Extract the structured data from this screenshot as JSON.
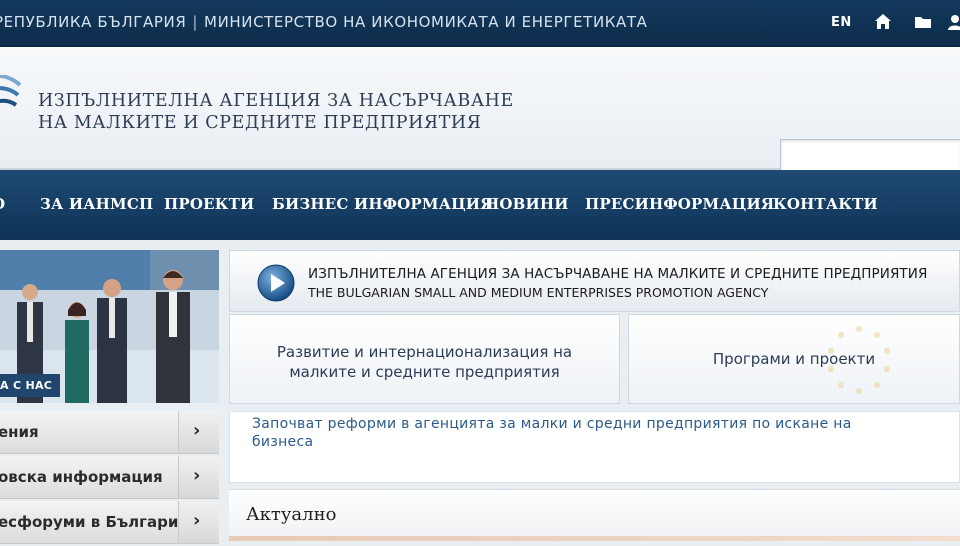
{
  "topbar": {
    "country": "РЕПУБЛИКА БЪЛГАРИЯ",
    "separator": "|",
    "ministry": "МИНИСТЕРСТВО НА ИКОНОМИКАТА И ЕНЕРГЕТИКАТА",
    "lang": "EN"
  },
  "header": {
    "agency_line1": "ИЗПЪЛНИТЕЛНА АГЕНЦИЯ ЗА НАСЪРЧАВАНЕ",
    "agency_line2": "НА МАЛКИТЕ И СРЕДНИТЕ ПРЕДПРИЯТИЯ",
    "search_placeholder": ""
  },
  "nav": {
    "items": [
      "О",
      "ЗА ИАНМСП",
      "ПРОЕКТИ",
      "БИЗНЕС ИНФОРМАЦИЯ",
      "НОВИНИ",
      "ПРЕСИНФОРМАЦИЯ",
      "КОНТАКТИ"
    ]
  },
  "photo": {
    "label": "А С НАС"
  },
  "side": {
    "items": [
      {
        "label": "ения",
        "arrow": "›"
      },
      {
        "label": "овска информация",
        "arrow": "›"
      },
      {
        "label": "есфоруми в България",
        "arrow": "›"
      }
    ]
  },
  "banner": {
    "line1": "ИЗПЪЛНИТЕЛНА АГЕНЦИЯ ЗА НАСЪРЧАВАНЕ НА МАЛКИТЕ И СРЕДНИТЕ ПРЕДПРИЯТИЯ",
    "line2": "THE BULGARIAN SMALL AND MEDIUM ENTERPRISES PROMOTION AGENCY"
  },
  "boxes": {
    "left_line1": "Развитие и интернационализация на",
    "left_line2": "малките и средните предприятия",
    "right": "Програми и проекти"
  },
  "news": {
    "link_line1": "Започват реформи в агенцията за малки и средни предприятия по искане на",
    "link_line2": "бизнеса"
  },
  "current": {
    "title": "Актуално"
  },
  "colors": {
    "brand_dark": "#0f3356",
    "link": "#2b5b8a"
  },
  "icons": [
    "home-icon",
    "folder-icon",
    "user-icon",
    "play-icon",
    "chevron-right-icon",
    "logo-arc-icon"
  ]
}
